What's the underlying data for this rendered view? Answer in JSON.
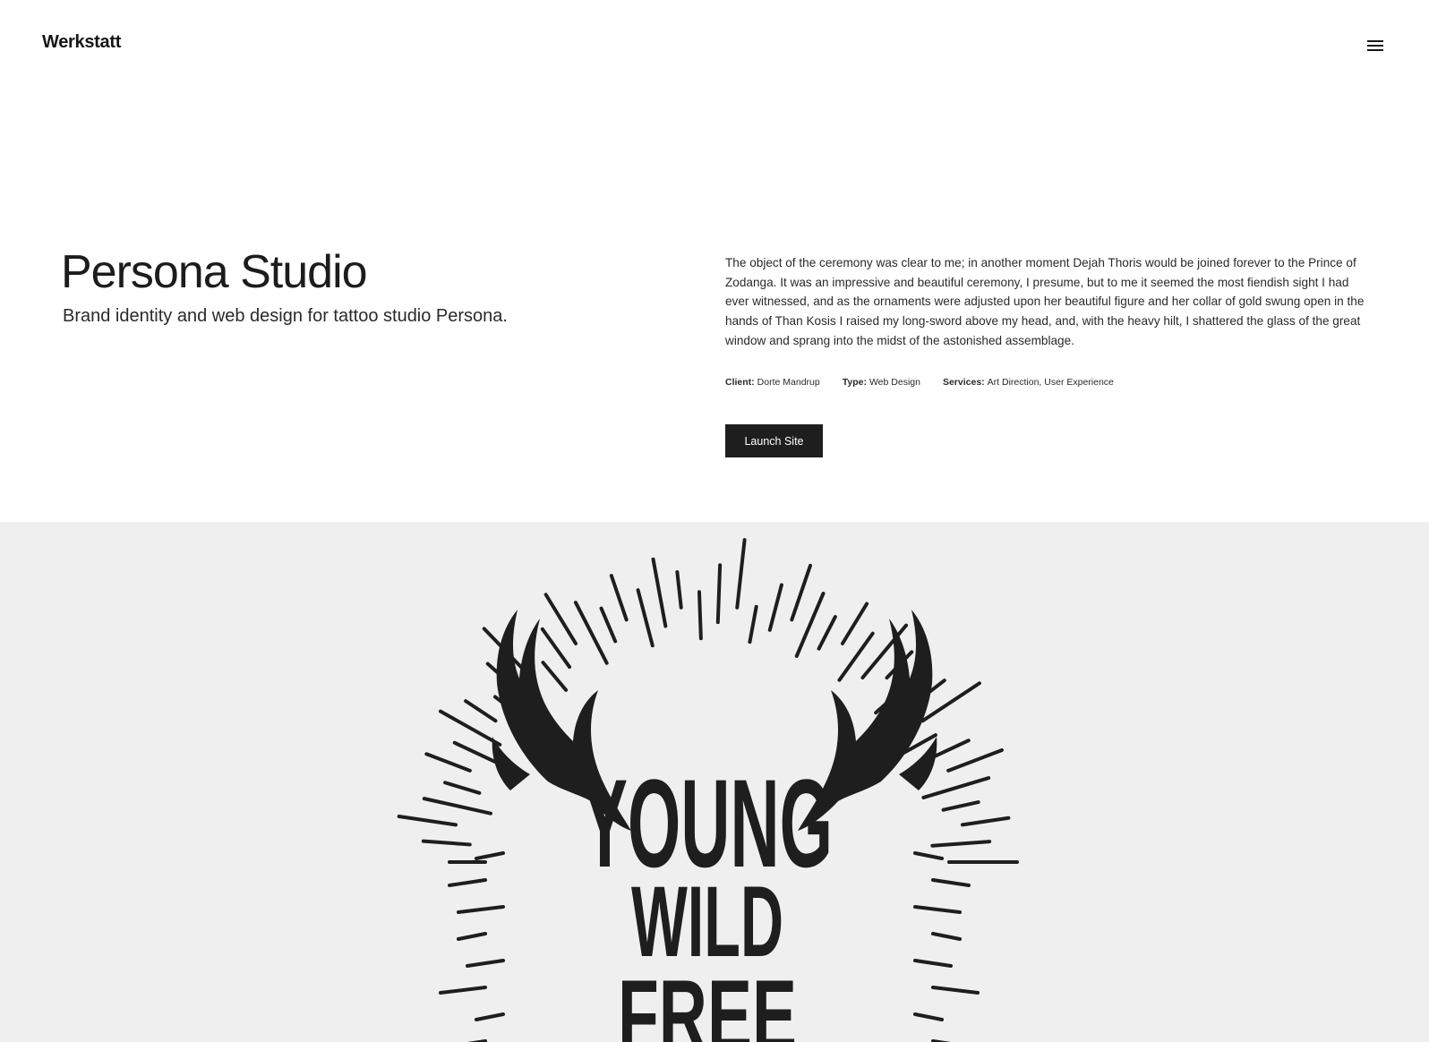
{
  "header": {
    "logo": "Werkstatt",
    "menu_icon": "hamburger-menu-icon"
  },
  "project": {
    "title": "Persona Studio",
    "subtitle": "Brand identity and web design for tattoo studio Persona.",
    "description": "The object of the ceremony was clear to me; in another moment Dejah Thoris would be joined forever to the Prince of Zodanga. It was an impressive and beautiful ceremony, I presume, but to me it seemed the most fiendish sight I had ever witnessed, and as the ornaments were adjusted upon her beautiful figure and her collar of gold swung open in the hands of Than Kosis I raised my long-sword above my head, and, with the heavy hilt, I shattered the glass of the great window and sprang into the midst of the astonished assemblage.",
    "meta": {
      "client_label": "Client:",
      "client_value": "Dorte Mandrup",
      "type_label": "Type:",
      "type_value": "Web Design",
      "services_label": "Services:",
      "services_value": "Art Direction, User Experience"
    },
    "launch_label": "Launch Site"
  },
  "showcase": {
    "artwork_lines": [
      "YOUNG",
      "WILD",
      "FREE"
    ],
    "artwork_icon": "antlers-sunburst-artwork",
    "background_color": "#efefef",
    "ink_color": "#1e1e1e"
  }
}
